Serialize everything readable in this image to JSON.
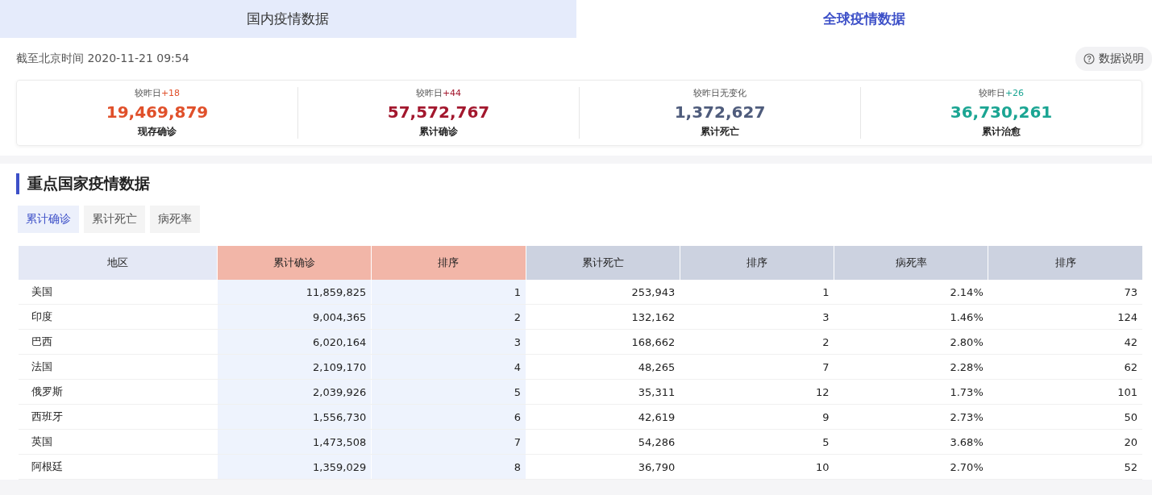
{
  "tabs": [
    {
      "label": "国内疫情数据",
      "selected": false
    },
    {
      "label": "全球疫情数据",
      "selected": true
    }
  ],
  "update_time": "截至北京时间 2020-11-21 09:54",
  "help_button": "数据说明",
  "summary": [
    {
      "change_label": "较昨日",
      "change": "+18",
      "value": "19,469,879",
      "label": "现存确诊",
      "color": "#e0502a"
    },
    {
      "change_label": "较昨日",
      "change": "+44",
      "value": "57,572,767",
      "label": "累计确诊",
      "color": "#a3182e"
    },
    {
      "change_label": "较昨日无变化",
      "value": "1,372,627",
      "label": "累计死亡",
      "color": "#4f5c7c"
    },
    {
      "change_label": "较昨日",
      "change": "+26",
      "value": "36,730,261",
      "label": "累计治愈",
      "color": "#1ba593"
    }
  ],
  "section_title": "重点国家疫情数据",
  "filters": [
    {
      "label": "累计确诊",
      "selected": true
    },
    {
      "label": "累计死亡",
      "selected": false
    },
    {
      "label": "病死率",
      "selected": false
    }
  ],
  "table": {
    "columns": [
      {
        "label": "地区",
        "highlighted": false
      },
      {
        "label": "累计确诊",
        "highlighted": true
      },
      {
        "label": "排序",
        "highlighted": true
      },
      {
        "label": "累计死亡",
        "highlighted": false
      },
      {
        "label": "排序",
        "highlighted": false
      },
      {
        "label": "病死率",
        "highlighted": false
      },
      {
        "label": "排序",
        "highlighted": false
      }
    ],
    "rows": [
      [
        "美国",
        "11,859,825",
        "1",
        "253,943",
        "1",
        "2.14%",
        "73"
      ],
      [
        "印度",
        "9,004,365",
        "2",
        "132,162",
        "3",
        "1.46%",
        "124"
      ],
      [
        "巴西",
        "6,020,164",
        "3",
        "168,662",
        "2",
        "2.80%",
        "42"
      ],
      [
        "法国",
        "2,109,170",
        "4",
        "48,265",
        "7",
        "2.28%",
        "62"
      ],
      [
        "俄罗斯",
        "2,039,926",
        "5",
        "35,311",
        "12",
        "1.73%",
        "101"
      ],
      [
        "西班牙",
        "1,556,730",
        "6",
        "42,619",
        "9",
        "2.73%",
        "50"
      ],
      [
        "英国",
        "1,473,508",
        "7",
        "54,286",
        "5",
        "3.68%",
        "20"
      ],
      [
        "阿根廷",
        "1,359,029",
        "8",
        "36,790",
        "10",
        "2.70%",
        "52"
      ]
    ]
  }
}
